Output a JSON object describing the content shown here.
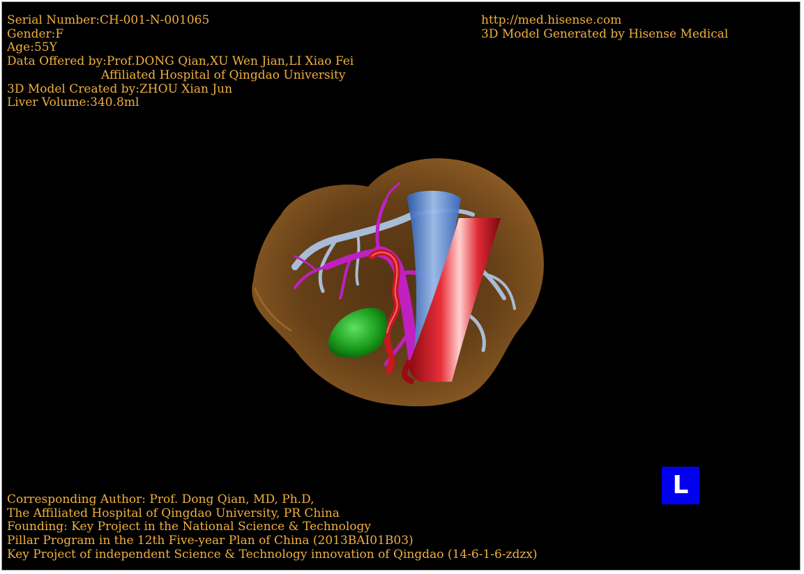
{
  "patient_info": {
    "serial_number": "Serial Number:CH-001-N-001065",
    "gender": "Gender:F",
    "age": "Age:55Y",
    "data_offered_by": "Data Offered by:Prof.DONG Qian,XU Wen Jian,LI Xiao Fei",
    "data_offered_affiliation": "Affiliated Hospital of Qingdao University",
    "model_created_by": "3D Model Created by:ZHOU Xian Jun",
    "liver_volume": "Liver Volume:340.8ml"
  },
  "branding": {
    "url": "http://med.hisense.com",
    "generator": "3D Model Generated by Hisense Medical"
  },
  "credits": {
    "line1": "Corresponding Author: Prof. Dong Qian, MD, Ph.D,",
    "line2": "The Affiliated Hospital of Qingdao University, PR China",
    "line3": "Founding: Key Project in the National Science & Technology",
    "line4": "Pillar Program in the 12th Five-year Plan of China (2013BAI01B03)",
    "line5": "Key Project of independent Science & Technology innovation of Qingdao (14-6-1-6-zdzx)"
  },
  "orientation_marker": "L",
  "colors": {
    "background": "#000000",
    "text": "#f0b040",
    "liver": "#8a5a26",
    "artery": "#d81c24",
    "portal_vein": "#c020c0",
    "hepatic_vein": "#a8bcd8",
    "ivc": "#5a8ad8",
    "gallbladder": "#1fae1f",
    "orientation_badge": "#0000ee"
  }
}
